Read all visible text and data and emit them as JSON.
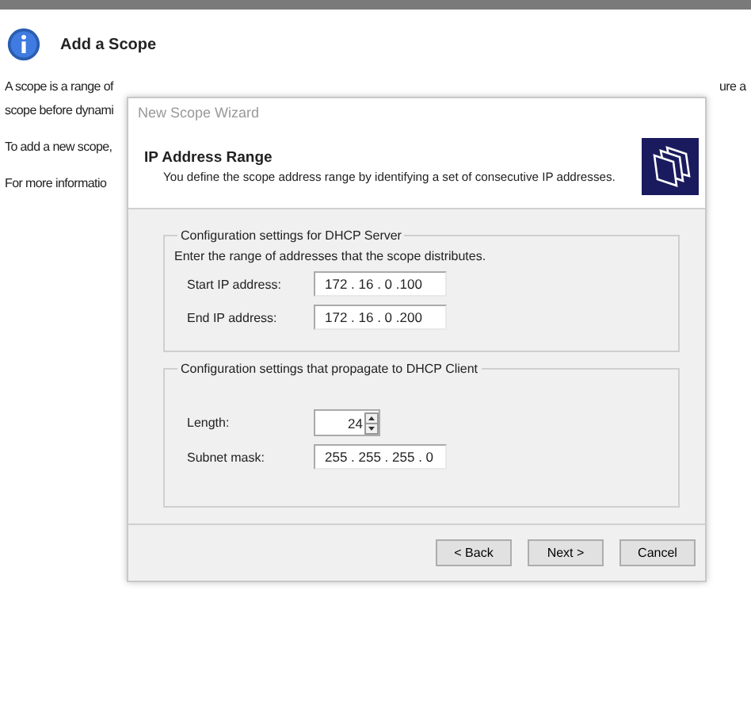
{
  "page": {
    "title": "Add a Scope",
    "lines": [
      {
        "left": "A scope is a range of",
        "right": "ure a"
      },
      {
        "left": "scope before dynami"
      },
      {
        "left": "To add a new scope,"
      },
      {
        "left": "For more informatio"
      }
    ]
  },
  "dialog": {
    "title": "New Scope Wizard",
    "heading": "IP Address Range",
    "subheading": "You define the scope address range by identifying a set of consecutive IP addresses.",
    "groups": [
      {
        "legend": "Configuration settings for DHCP Server",
        "intro": "Enter the range of addresses that the scope distributes.",
        "fields": [
          {
            "kind": "ip",
            "label": "Start IP address:",
            "value": "172 . 16 . 0 .100"
          },
          {
            "kind": "ip",
            "label": "End IP address:",
            "value": "172 . 16 . 0 .200"
          }
        ]
      },
      {
        "legend": "Configuration settings that propagate to DHCP Client",
        "fields": [
          {
            "kind": "spin",
            "label": "Length:",
            "value": "24"
          },
          {
            "kind": "ip",
            "label": "Subnet mask:",
            "value": "255 . 255 . 255 . 0"
          }
        ]
      }
    ],
    "buttons": [
      "< Back",
      "Next >",
      "Cancel"
    ]
  }
}
